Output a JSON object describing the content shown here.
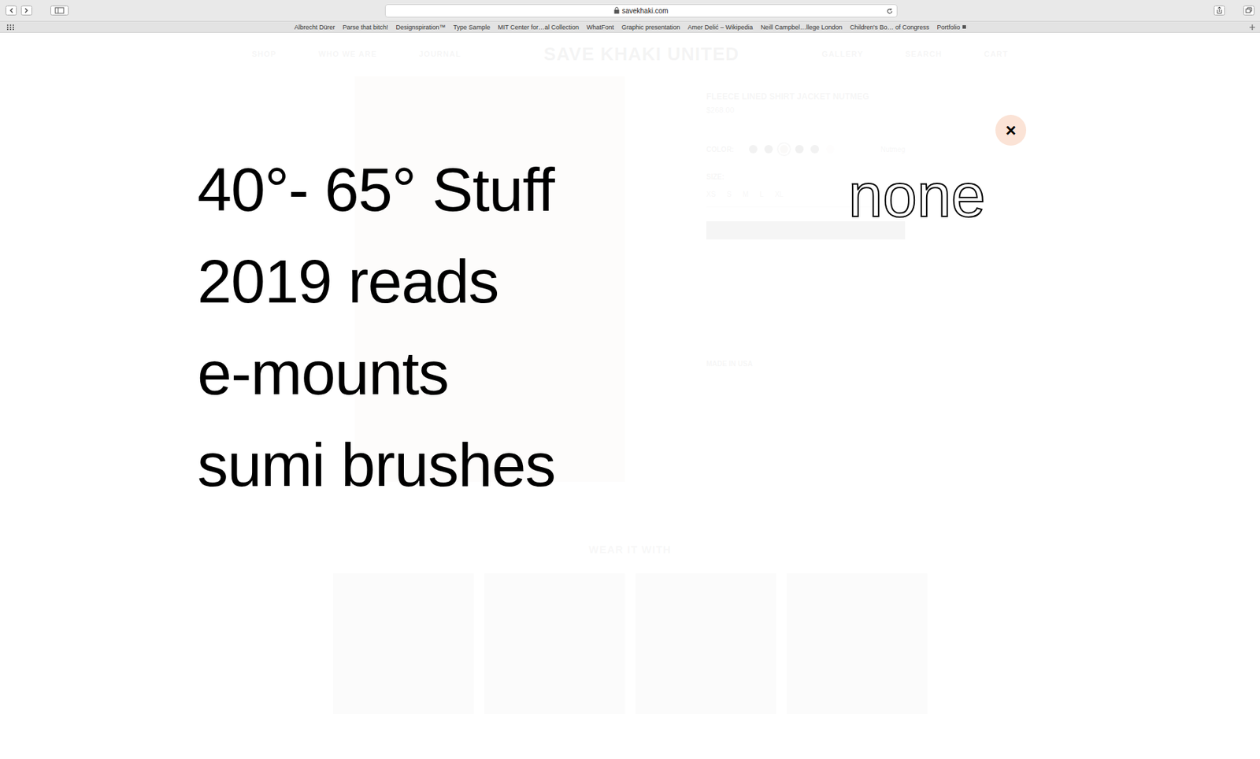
{
  "browser": {
    "url": "savekhaki.com",
    "bookmarks": [
      "Albrecht Dürer",
      "Parse that bitch!",
      "Designspiration™",
      "Type Sample",
      "MIT Center for…al Collection",
      "WhatFont",
      "Graphic presentation",
      "Amer Delić – Wikipedia",
      "Neill Campbel…llege London",
      "Children's Bo… of Congress",
      "Portfolio"
    ]
  },
  "site": {
    "nav_left": [
      "SHOP",
      "WHO WE ARE",
      "JOURNAL"
    ],
    "logo": "SAVE KHAKI UNITED",
    "nav_right": [
      "GALLERY",
      "SEARCH",
      "CART"
    ],
    "product": {
      "title": "FLEECE LINED SHIRT JACKET NUTMEG",
      "price": "$268.00",
      "color_label": "COLOR:",
      "color_name": "Nutmeg",
      "swatches": [
        {
          "color": "#4a4a4a",
          "selected": false
        },
        {
          "color": "#3a3a3a",
          "selected": false
        },
        {
          "color": "#b9aa9a",
          "selected": true
        },
        {
          "color": "#2f2f2f",
          "selected": false
        },
        {
          "color": "#444444",
          "selected": false
        },
        {
          "color": "#e6e0d8",
          "selected": false
        }
      ],
      "size_label": "SIZE:",
      "sizes": [
        "XS",
        "S",
        "M",
        "L",
        "XL"
      ],
      "made_in": "MADE IN USA"
    },
    "wear_with_title": "WEAR IT WITH",
    "wear_with_count": 4
  },
  "overlay": {
    "items": [
      "40°- 65° Stuff",
      "2019 reads",
      "e-mounts",
      "sumi brushes"
    ],
    "aside": "none",
    "close": "×"
  }
}
